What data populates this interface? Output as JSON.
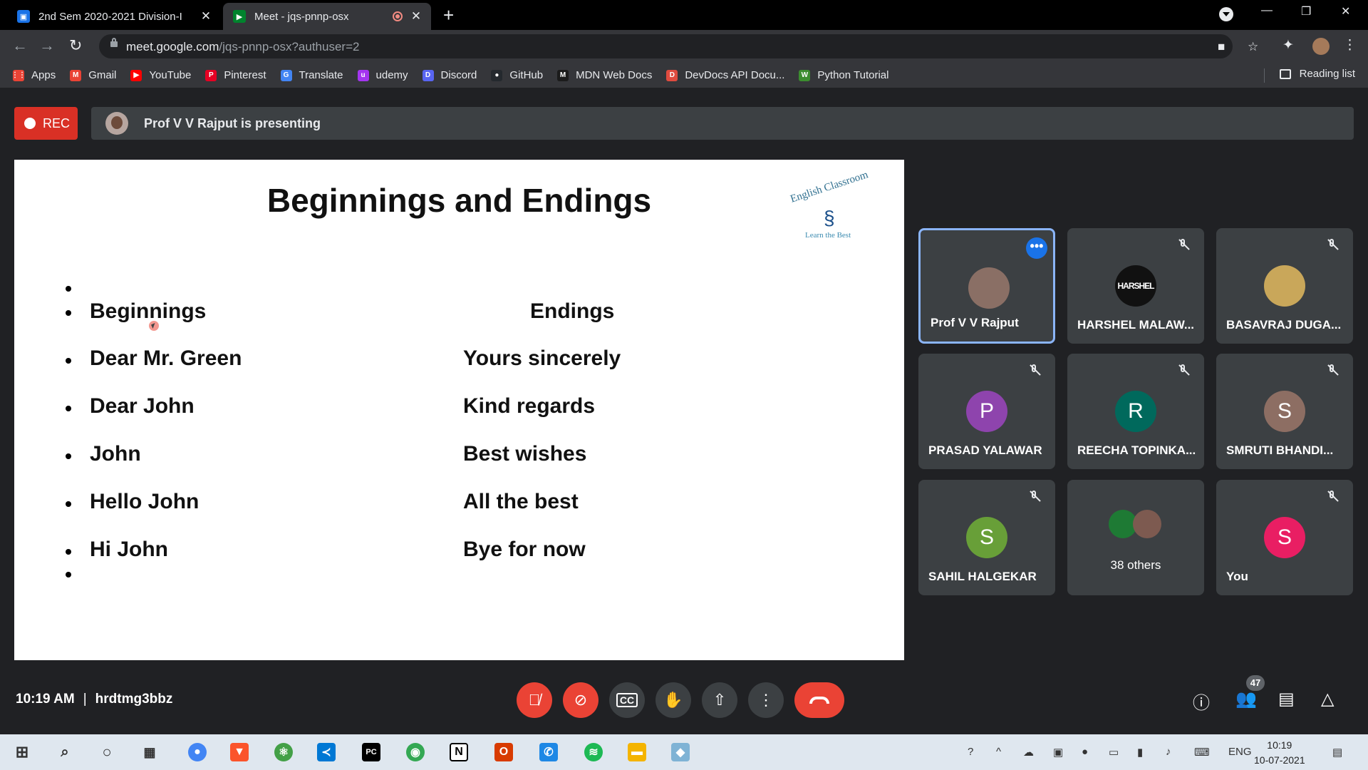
{
  "browser": {
    "tabs": [
      {
        "title": "2nd Sem 2020-2021 Division-I",
        "favicon_color": "#1a73e8"
      },
      {
        "title": "Meet - jqs-pnnp-osx",
        "favicon_color": "#00832d"
      }
    ],
    "new_tab_symbol": "+",
    "window_controls": {
      "minimize": "—",
      "restore": "❐",
      "close": "✕"
    },
    "url_host": "meet.google.com",
    "url_path": "/jqs-pnnp-osx?authuser=2",
    "bookmarks": [
      {
        "label": "Apps",
        "color": "#ea4335",
        "glyph": "⋮⋮"
      },
      {
        "label": "Gmail",
        "color": "#ea4335",
        "glyph": "M"
      },
      {
        "label": "YouTube",
        "color": "#ff0000",
        "glyph": "▶"
      },
      {
        "label": "Pinterest",
        "color": "#e60023",
        "glyph": "P"
      },
      {
        "label": "Translate",
        "color": "#4285f4",
        "glyph": "G"
      },
      {
        "label": "udemy",
        "color": "#a435f0",
        "glyph": "u"
      },
      {
        "label": "Discord",
        "color": "#5865f2",
        "glyph": "D"
      },
      {
        "label": "GitHub",
        "color": "#24292e",
        "glyph": "●"
      },
      {
        "label": "MDN Web Docs",
        "color": "#1b1b1b",
        "glyph": "M"
      },
      {
        "label": "DevDocs API Docu...",
        "color": "#e04b3f",
        "glyph": "D"
      },
      {
        "label": "Python Tutorial",
        "color": "#3c8d2f",
        "glyph": "W"
      }
    ],
    "reading_list": "Reading list"
  },
  "meet": {
    "rec_label": "REC",
    "presenting_text": "Prof V V Rajput is presenting",
    "slide": {
      "title": "Beginnings and Endings",
      "logo_text": "English Classroom",
      "logo_sub": "Learn the Best",
      "headers": {
        "left": "Beginnings",
        "right": "Endings"
      },
      "rows": [
        {
          "left": "Dear Mr. Green",
          "right": "Yours sincerely"
        },
        {
          "left": "Dear John",
          "right": "Kind regards"
        },
        {
          "left": "John",
          "right": "Best wishes"
        },
        {
          "left": "Hello John",
          "right": "All the best"
        },
        {
          "left": "Hi John",
          "right": "Bye for now"
        }
      ]
    },
    "participants": [
      {
        "name": "Prof V V Rajput",
        "initial": "",
        "color": "#8a6f65",
        "muted": false,
        "active": true
      },
      {
        "name": "HARSHEL MALAW...",
        "initial": "HARSHEL",
        "color": "#111111",
        "muted": true,
        "active": false
      },
      {
        "name": "BASAVRAJ DUGA...",
        "initial": "",
        "color": "#c9a75a",
        "muted": true,
        "active": false
      },
      {
        "name": "PRASAD YALAWAR",
        "initial": "P",
        "color": "#8e44ad",
        "muted": true,
        "active": false
      },
      {
        "name": "REECHA TOPINKA...",
        "initial": "R",
        "color": "#00695c",
        "muted": true,
        "active": false
      },
      {
        "name": "SMRUTI BHANDI...",
        "initial": "S",
        "color": "#8d6e63",
        "muted": true,
        "active": false
      },
      {
        "name": "SAHIL HALGEKAR",
        "initial": "S",
        "color": "#689f38",
        "muted": true,
        "active": false
      },
      {
        "name": "38 others",
        "initial": "",
        "color": "#3c4043",
        "muted": false,
        "active": false
      },
      {
        "name": "You",
        "initial": "S",
        "color": "#e91e63",
        "muted": true,
        "active": false
      }
    ],
    "bottom": {
      "time": "10:19 AM",
      "meeting_code": "hrdtmg3bbz",
      "people_count": "47"
    }
  },
  "taskbar": {
    "lang": "ENG",
    "time": "10:19",
    "date": "10-07-2021"
  }
}
